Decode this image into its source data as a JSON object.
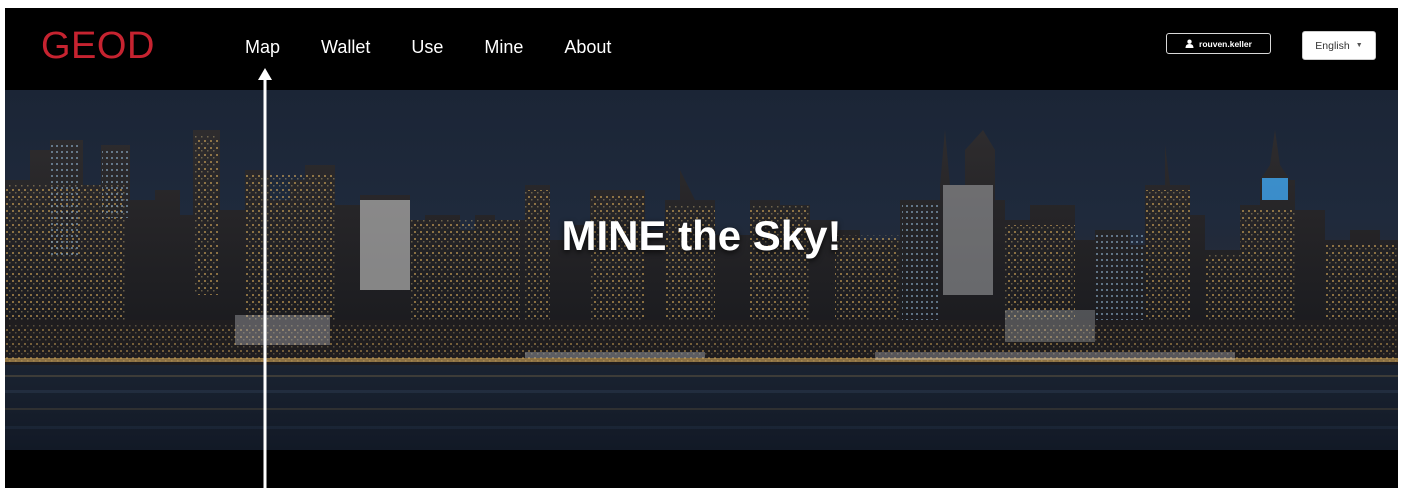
{
  "brand": {
    "name": "GEOD",
    "color": "#c62330"
  },
  "nav": {
    "items": [
      {
        "label": "Map",
        "key": "map"
      },
      {
        "label": "Wallet",
        "key": "wallet"
      },
      {
        "label": "Use",
        "key": "use"
      },
      {
        "label": "Mine",
        "key": "mine"
      },
      {
        "label": "About",
        "key": "about"
      }
    ]
  },
  "user": {
    "username": "rouven.keller",
    "icon": "user-icon"
  },
  "language": {
    "selected": "English",
    "icon": "caret-down-icon"
  },
  "hero": {
    "title": "MINE the Sky!"
  },
  "annotation": {
    "icon": "up-arrow-icon",
    "color": "#ffffff"
  }
}
